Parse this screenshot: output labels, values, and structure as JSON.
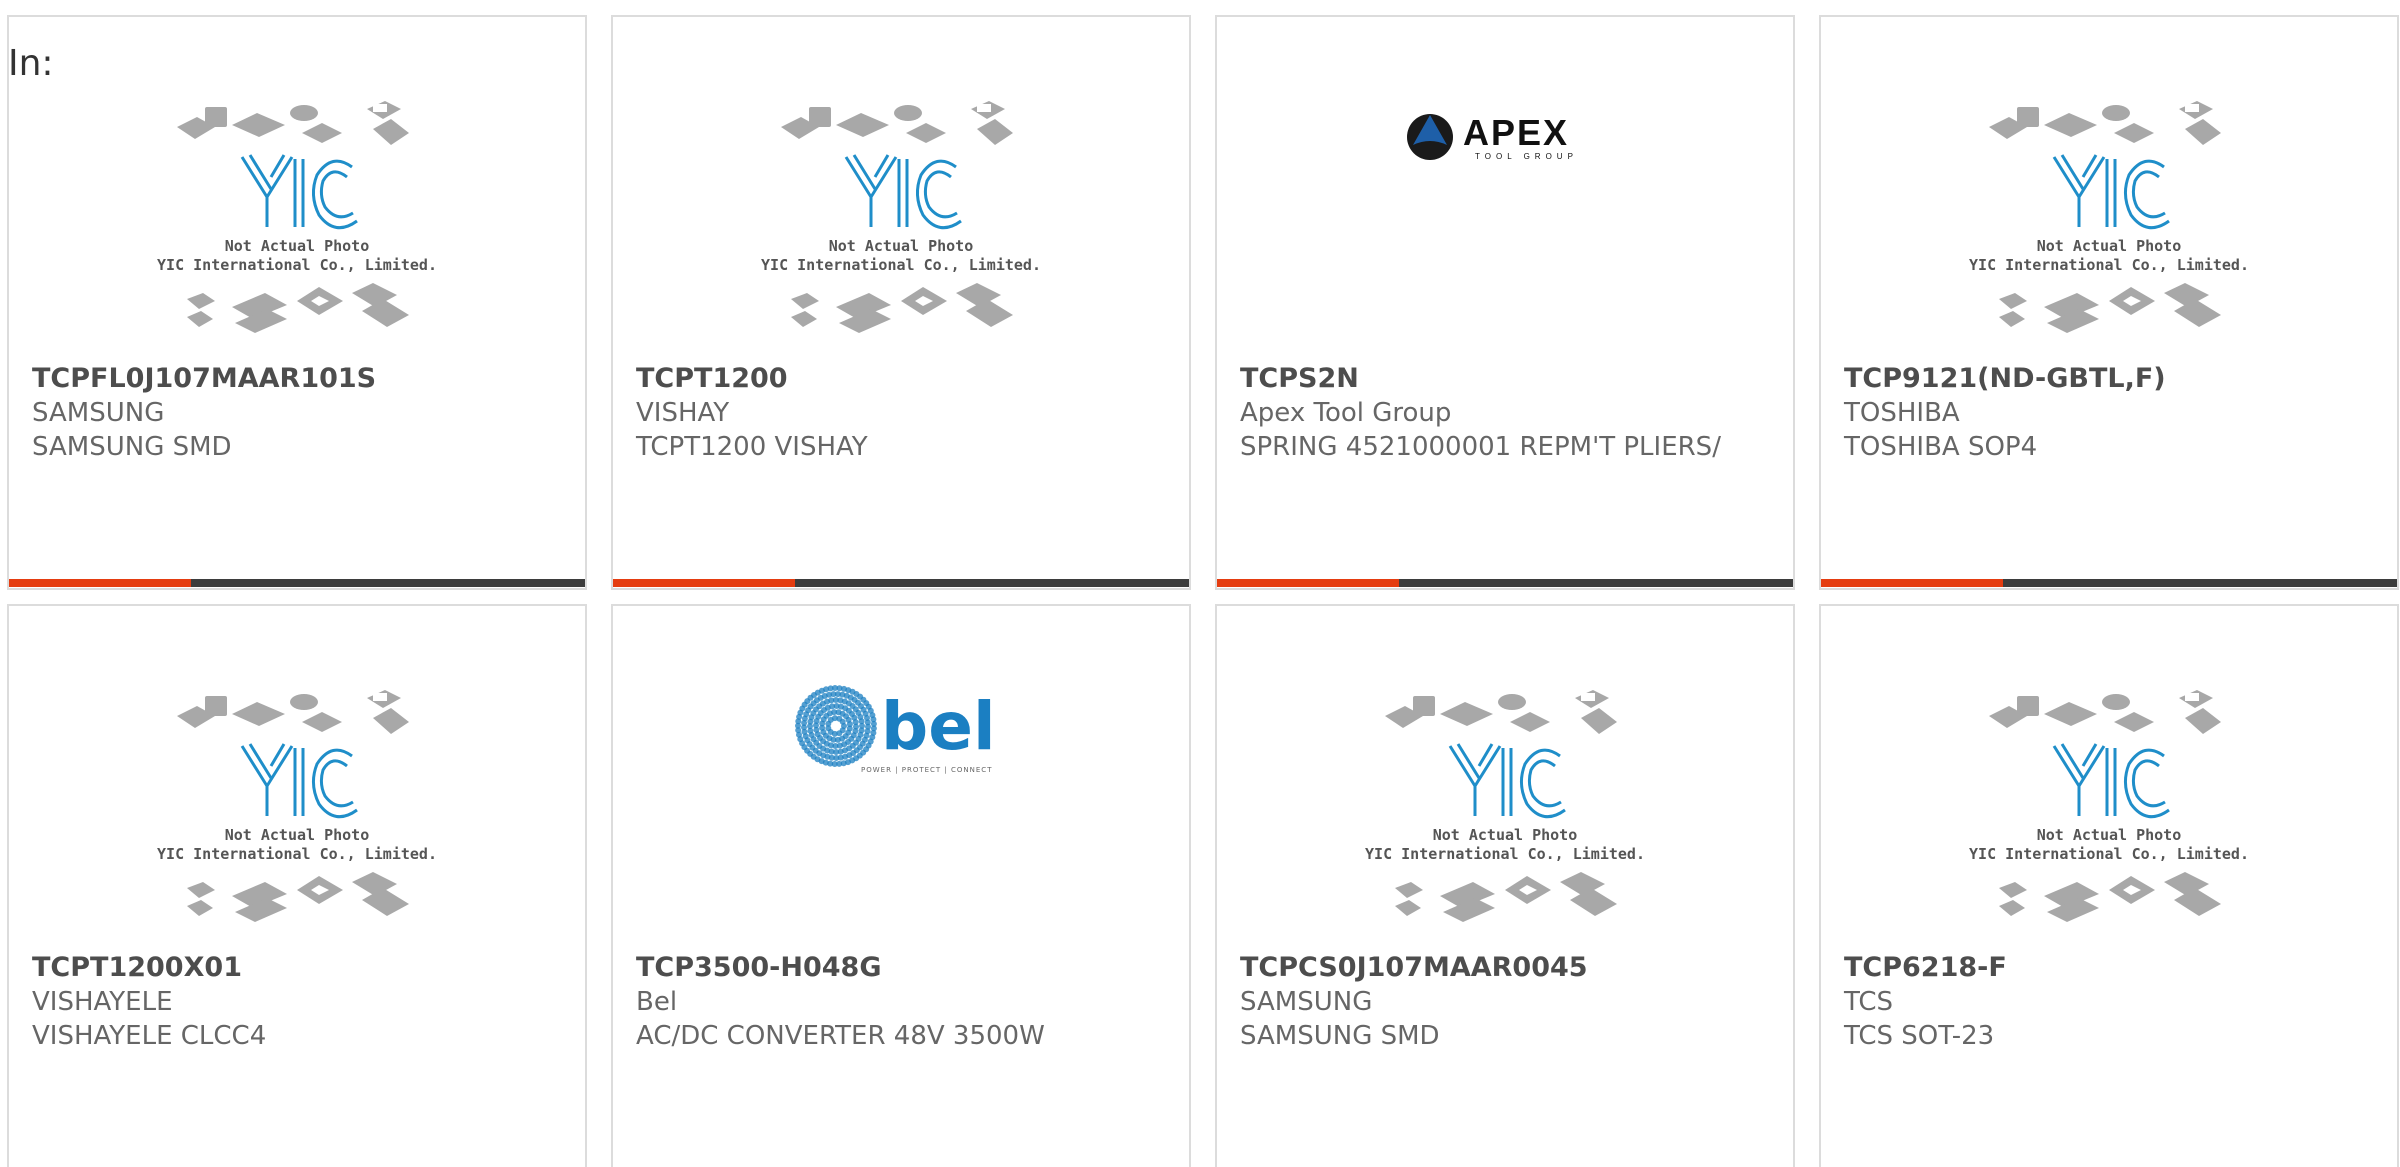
{
  "filter_label": "In:",
  "placeholder_photo": {
    "caption_line1": "Not Actual Photo",
    "caption_line2": "YIC International Co., Limited.",
    "logo_text": "YIC"
  },
  "brand_logos": {
    "apex": {
      "wordmark": "APEX",
      "tagline": "TOOL GROUP"
    },
    "bel": {
      "wordmark": "bel",
      "tagline": "POWER | PROTECT | CONNECT"
    }
  },
  "colors": {
    "accent": "#e53d11",
    "bar_dark": "#3d3d3d",
    "yic_blue": "#1f8ec9",
    "bel_blue": "#1b7fc2",
    "chip_gray": "#a8a8a8"
  },
  "products": [
    {
      "part": "TCPFL0J107MAAR101S",
      "brand": "SAMSUNG",
      "desc": "SAMSUNG SMD",
      "image": "yic-placeholder"
    },
    {
      "part": "TCPT1200",
      "brand": "VISHAY",
      "desc": "TCPT1200 VISHAY",
      "image": "yic-placeholder"
    },
    {
      "part": "TCPS2N",
      "brand": "Apex Tool Group",
      "desc": "SPRING 4521000001 REPM'T PLIERS/",
      "image": "apex-logo"
    },
    {
      "part": "TCP9121(ND-GBTL,F)",
      "brand": "TOSHIBA",
      "desc": "TOSHIBA SOP4",
      "image": "yic-placeholder"
    },
    {
      "part": "TCPT1200X01",
      "brand": "VISHAYELE",
      "desc": "VISHAYELE CLCC4",
      "image": "yic-placeholder"
    },
    {
      "part": "TCP3500-H048G",
      "brand": "Bel",
      "desc": "AC/DC CONVERTER 48V 3500W",
      "image": "bel-logo"
    },
    {
      "part": "TCPCS0J107MAAR0045",
      "brand": "SAMSUNG",
      "desc": "SAMSUNG SMD",
      "image": "yic-placeholder"
    },
    {
      "part": "TCP6218-F",
      "brand": "TCS",
      "desc": "TCS SOT-23",
      "image": "yic-placeholder"
    }
  ]
}
